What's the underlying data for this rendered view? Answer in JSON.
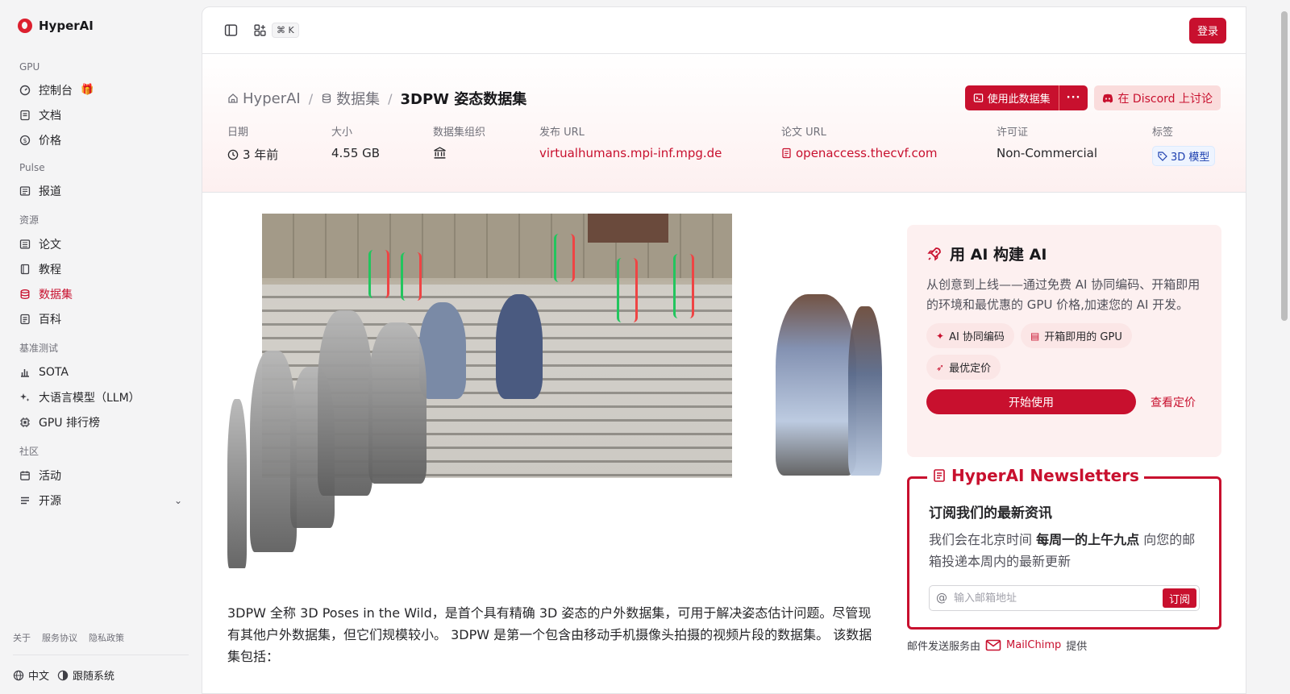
{
  "brand": {
    "name": "HyperAI"
  },
  "sidebar": {
    "sections": [
      {
        "title": "GPU",
        "items": [
          {
            "label": "控制台",
            "icon": "gauge-icon"
          },
          {
            "label": "文档",
            "icon": "doc-icon"
          },
          {
            "label": "价格",
            "icon": "dollar-icon"
          }
        ]
      },
      {
        "title": "Pulse",
        "items": [
          {
            "label": "报道",
            "icon": "news-icon"
          }
        ]
      },
      {
        "title": "资源",
        "items": [
          {
            "label": "论文",
            "icon": "paper-icon"
          },
          {
            "label": "教程",
            "icon": "book-icon"
          },
          {
            "label": "数据集",
            "icon": "database-icon"
          },
          {
            "label": "百科",
            "icon": "wiki-icon"
          }
        ]
      },
      {
        "title": "基准测试",
        "items": [
          {
            "label": "SOTA",
            "icon": "chart-icon"
          },
          {
            "label": "大语言模型（LLM）",
            "icon": "sparkle-icon"
          },
          {
            "label": "GPU 排行榜",
            "icon": "chip-icon"
          }
        ]
      },
      {
        "title": "社区",
        "items": [
          {
            "label": "活动",
            "icon": "calendar-icon"
          },
          {
            "label": "开源",
            "icon": "list-icon"
          }
        ]
      }
    ],
    "footer_links": [
      "关于",
      "服务协议",
      "隐私政策"
    ],
    "language": "中文",
    "theme": "跟随系统"
  },
  "topbar": {
    "shortcut": "⌘ K",
    "login": "登录"
  },
  "breadcrumb": {
    "home": "HyperAI",
    "datasets": "数据集",
    "current": "3DPW 姿态数据集"
  },
  "actions": {
    "use_dataset": "使用此数据集",
    "more": "···",
    "discord": "在 Discord 上讨论"
  },
  "meta": {
    "date_label": "日期",
    "date_value": "3 年前",
    "size_label": "大小",
    "size_value": "4.55 GB",
    "org_label": "数据集组织",
    "release_label": "发布 URL",
    "release_value": "virtualhumans.mpi-inf.mpg.de",
    "paper_label": "论文 URL",
    "paper_value": "openaccess.thecvf.com",
    "license_label": "许可证",
    "license_value": "Non-Commercial",
    "tags_label": "标签",
    "tag_value": "3D 模型"
  },
  "description": "3DPW 全称 3D Poses in the Wild，是首个具有精确 3D 姿态的户外数据集，可用于解决姿态估计问题。尽管现有其他户外数据集，但它们规模较小。 3DPW 是第一个包含由移动手机摄像头拍摄的视频片段的数据集。 该数据集包括：",
  "promo": {
    "title": "用 AI 构建 AI",
    "text": "从创意到上线——通过免费 AI 协同编码、开箱即用的环境和最优惠的 GPU 价格,加速您的 AI 开发。",
    "chips": [
      "AI 协同编码",
      "开箱即用的 GPU",
      "最优定价"
    ],
    "start": "开始使用",
    "pricing": "查看定价"
  },
  "newsletter": {
    "title": "HyperAI Newsletters",
    "heading": "订阅我们的最新资讯",
    "text_pre": "我们会在北京时间 ",
    "text_bold": "每周一的上午九点",
    "text_post": " 向您的邮箱投递本周内的最新更新",
    "placeholder": "输入邮箱地址",
    "subscribe": "订阅",
    "note_pre": "邮件发送服务由",
    "note_brand": "MailChimp",
    "note_post": "提供"
  },
  "colors": {
    "accent": "#c8102e",
    "accent_soft": "#fdf0f0"
  }
}
